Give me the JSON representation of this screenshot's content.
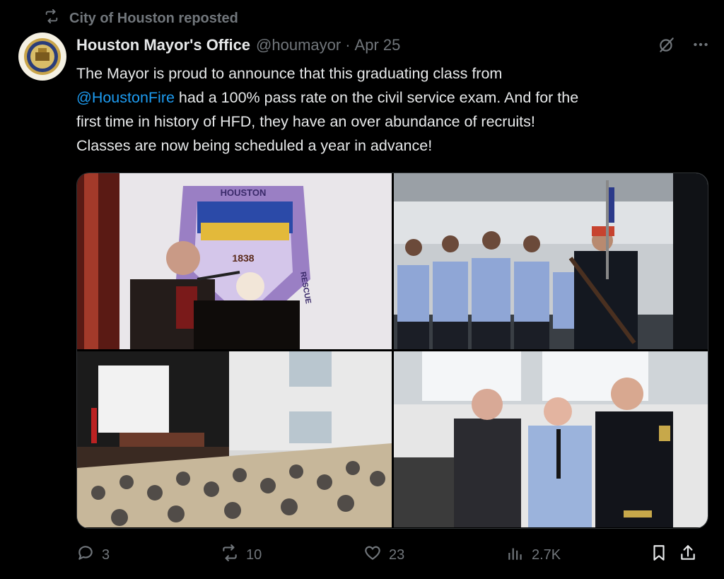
{
  "repost": {
    "text": "City of Houston reposted"
  },
  "author": {
    "display_name": "Houston Mayor's Office",
    "handle": "@houmayor",
    "separator": "·",
    "date": "Apr 25"
  },
  "tweet": {
    "lines": [
      {
        "pre": "The Mayor is proud to announce that this graduating  class from",
        "mention": "",
        "post": ""
      },
      {
        "pre": "",
        "mention": "@HoustonFire",
        "post": "  had a 100% pass rate on the civil service exam. And for the"
      },
      {
        "pre": "first time in history of HFD, they have an over abundance of recruits!",
        "mention": "",
        "post": ""
      },
      {
        "pre": "Classes are now being scheduled a year in advance!",
        "mention": "",
        "post": ""
      }
    ]
  },
  "media": {
    "photo1": {
      "badge_top": "HOUSTON",
      "badge_left": "FI",
      "badge_right": "RESCUE",
      "badge_year": "1838"
    }
  },
  "actions": {
    "replies": "3",
    "reposts": "10",
    "likes": "23",
    "views": "2.7K"
  },
  "icons": {
    "repost": "repost-icon",
    "grok": "grok-icon",
    "more": "more-icon",
    "reply": "reply-icon",
    "like": "heart-icon",
    "views": "views-icon",
    "bookmark": "bookmark-icon",
    "share": "share-icon"
  },
  "colors": {
    "background": "#000000",
    "text": "#e7e9ea",
    "muted": "#71767b",
    "link": "#1d9bf0"
  }
}
